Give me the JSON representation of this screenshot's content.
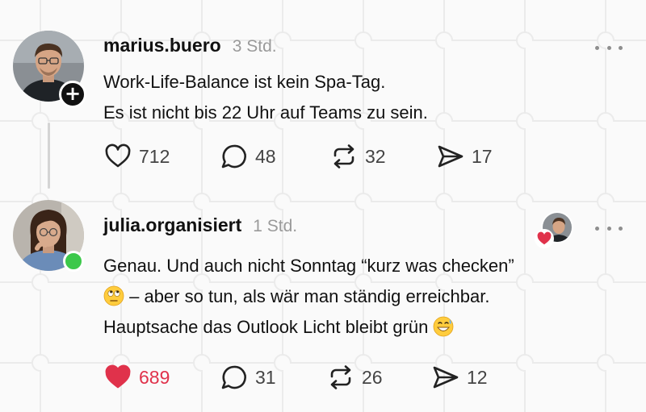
{
  "posts": [
    {
      "username": "marius.buero",
      "time": "3 Std.",
      "lines": [
        "Work-Life-Balance ist kein Spa-Tag.",
        "Es ist nicht bis 22 Uhr auf Teams zu sein."
      ],
      "actions": {
        "likes": "712",
        "replies": "48",
        "reposts": "32",
        "shares": "17"
      },
      "liked": false,
      "avatar_icon": "person-avatar",
      "badge_icon": "plus-icon"
    },
    {
      "username": "julia.organisiert",
      "time": "1 Std.",
      "lines": [
        "Genau. Und auch nicht Sonntag “kurz was checken”",
        " – aber so tun, als wär man ständig erreichbar.",
        "Hauptsache das Outlook Licht bleibt grün "
      ],
      "actions": {
        "likes": "689",
        "replies": "31",
        "reposts": "26",
        "shares": "12"
      },
      "liked": true,
      "avatar_icon": "person-avatar",
      "status_icon": "online-status-dot",
      "emojis": [
        "face-with-rolling-eyes-emoji",
        "grinning-face-with-sweat-emoji"
      ]
    }
  ],
  "colors": {
    "like_active": "#e0324b",
    "online": "#3cc84a",
    "text": "#111111",
    "muted": "#9a9a9a"
  }
}
